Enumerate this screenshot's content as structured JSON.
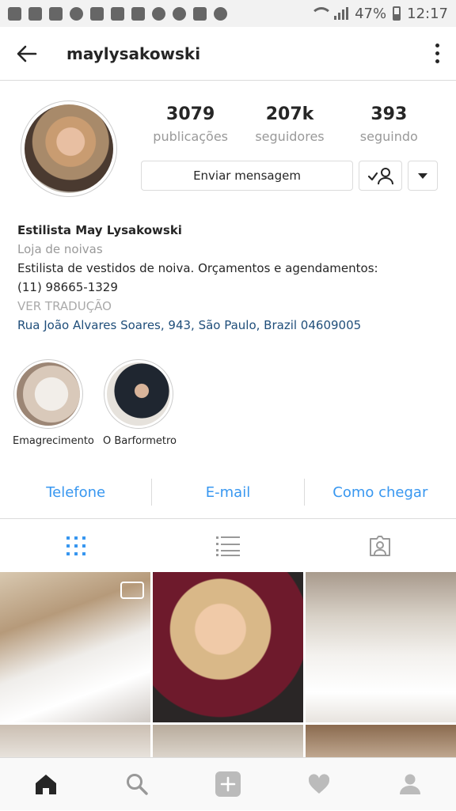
{
  "status_bar": {
    "battery": "47%",
    "time": "12:17"
  },
  "header": {
    "username": "maylysakowski"
  },
  "profile": {
    "stats": [
      {
        "value": "3079",
        "label": "publicações"
      },
      {
        "value": "207k",
        "label": "seguidores"
      },
      {
        "value": "393",
        "label": "seguindo"
      }
    ],
    "message_button": "Enviar mensagem"
  },
  "bio": {
    "name": "Estilista May Lysakowski",
    "category": "Loja de noivas",
    "description": "Estilista de vestidos de noiva. Orçamentos e agendamentos:",
    "phone": "(11) 98665-1329",
    "translate": "VER TRADUÇÃO",
    "address": "Rua João Alvares Soares, 943, São Paulo, Brazil 04609005"
  },
  "highlights": [
    {
      "label": "Emagrecimento"
    },
    {
      "label": "O Barformetro"
    }
  ],
  "contacts": {
    "phone": "Telefone",
    "email": "E-mail",
    "directions": "Como chegar"
  },
  "colors": {
    "link_blue": "#3897f0",
    "address_blue": "#1f4e7a",
    "muted": "#999999"
  }
}
